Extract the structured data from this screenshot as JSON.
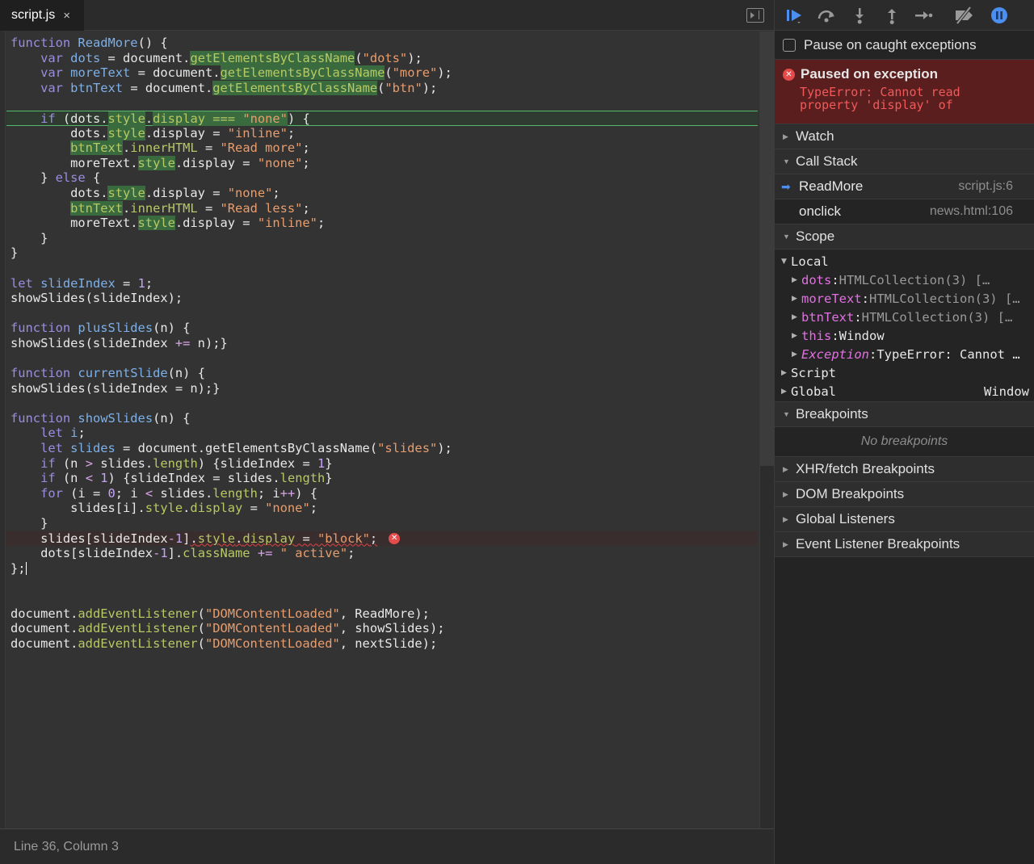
{
  "editor": {
    "tab_label": "script.js",
    "tab_close": "×",
    "status": "Line 36, Column 3"
  },
  "debugger": {
    "pause_caught_label": "Pause on caught exceptions",
    "exception": {
      "title": "Paused on exception",
      "message": "TypeError: Cannot read property 'display' of"
    },
    "sections": {
      "watch": "Watch",
      "call_stack": "Call Stack",
      "scope": "Scope",
      "breakpoints": "Breakpoints",
      "xhr": "XHR/fetch Breakpoints",
      "dom": "DOM Breakpoints",
      "global_listeners": "Global Listeners",
      "event_listener": "Event Listener Breakpoints"
    },
    "call_stack": [
      {
        "name": "ReadMore",
        "location": "script.js:6"
      },
      {
        "name": "onclick",
        "location": "news.html:106"
      }
    ],
    "scope": {
      "local_label": "Local",
      "dots_key": "dots",
      "dots_val": "HTMLCollection(3) […",
      "more_key": "moreText",
      "more_val": "HTMLCollection(3) […",
      "btn_key": "btnText",
      "btn_val": "HTMLCollection(3) […",
      "this_key": "this",
      "this_val": "Window",
      "exc_key": "Exception",
      "exc_val": "TypeError: Cannot …",
      "script_label": "Script",
      "global_label": "Global",
      "global_val": "Window"
    },
    "no_breakpoints": "No breakpoints"
  },
  "colors": {
    "exception_bg": "#5a1e1e",
    "error_red": "#e54b4b",
    "exec_line": "#55b96b",
    "accent_blue": "#4c8ff0"
  }
}
